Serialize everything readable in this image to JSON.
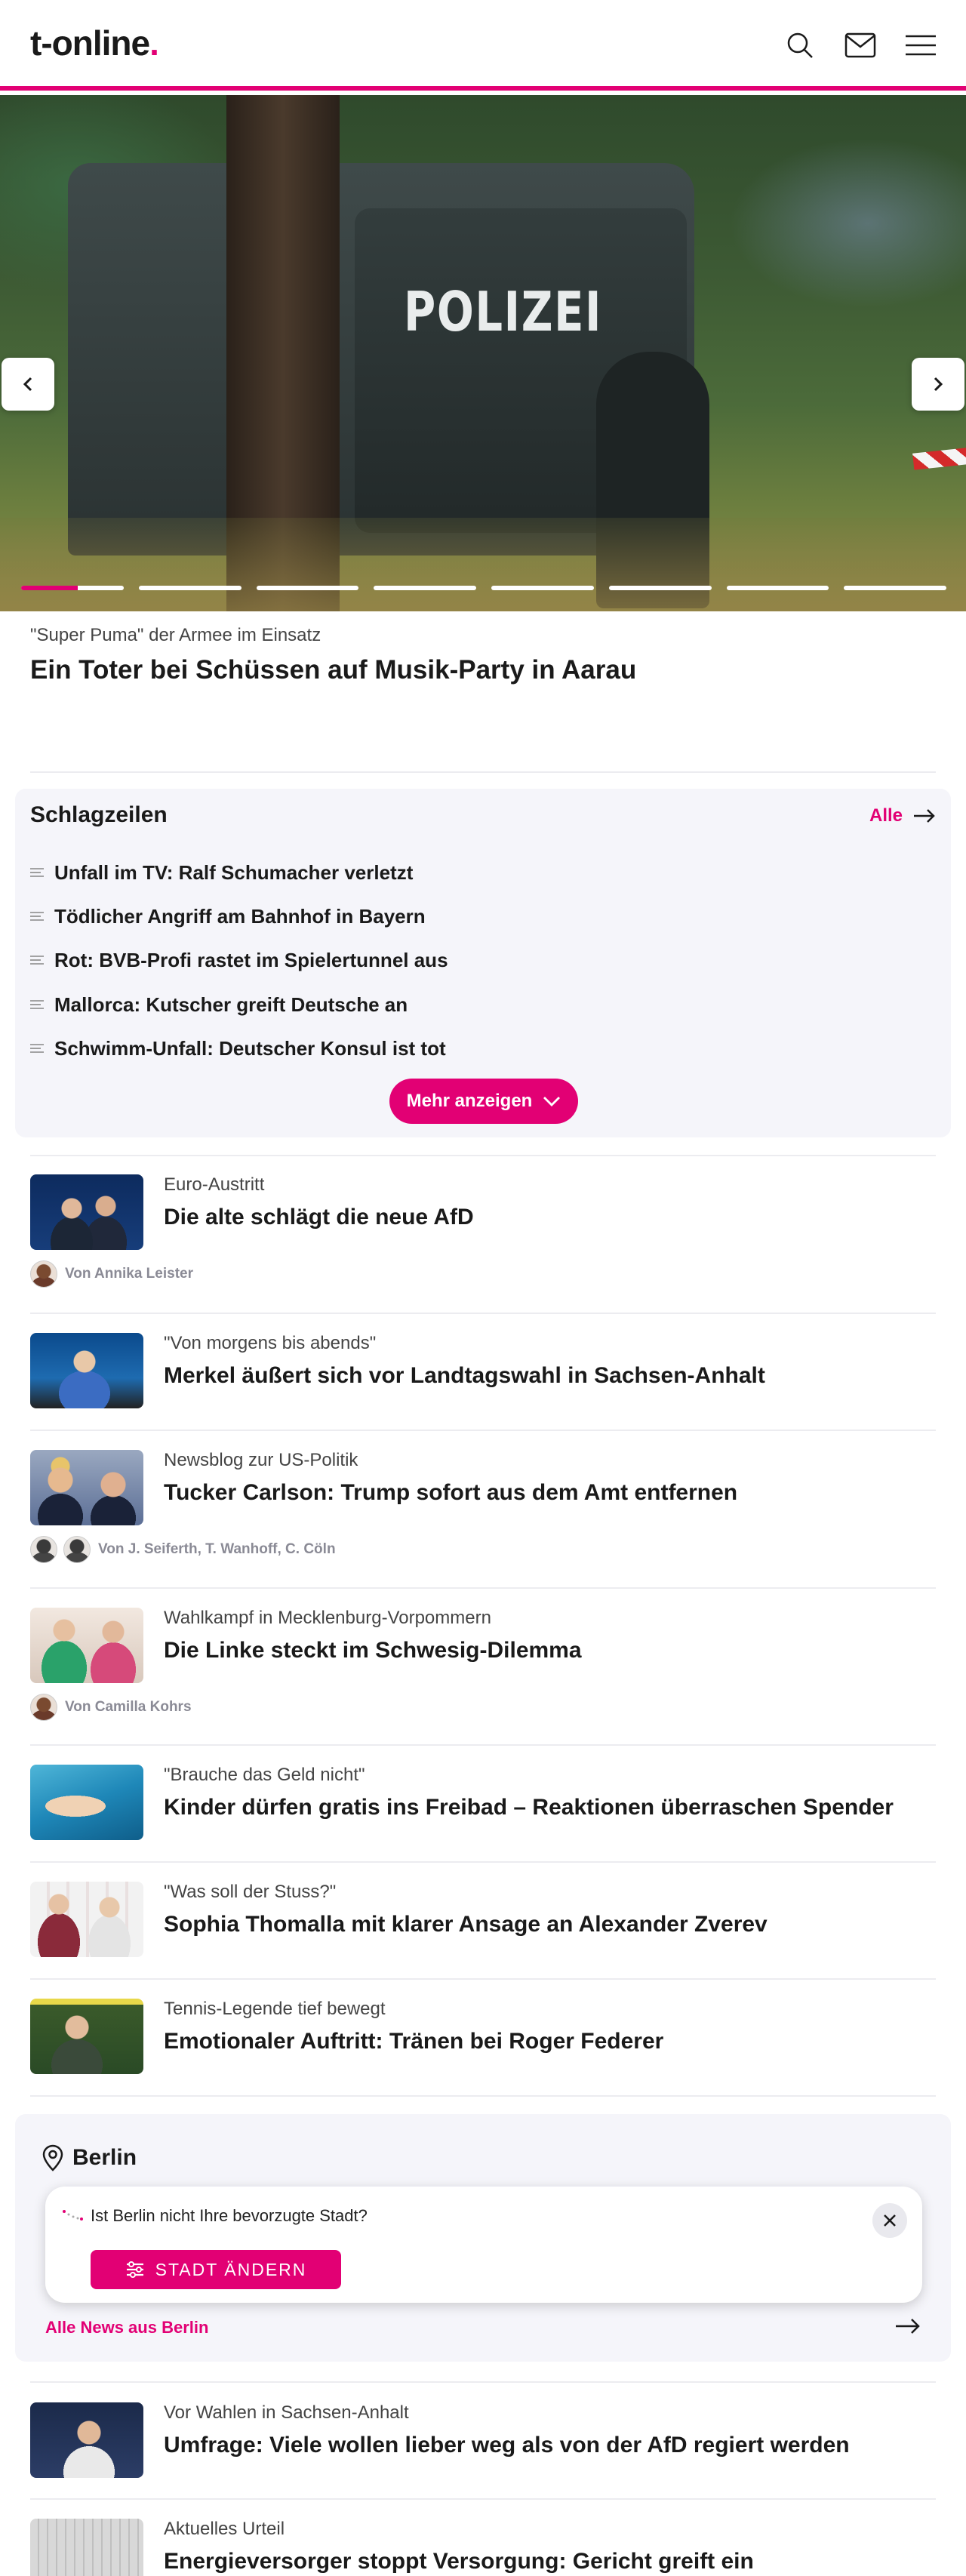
{
  "header": {
    "logo_text": "t-online",
    "logo_dot": "."
  },
  "hero": {
    "vehicle_text": "POLIZEI",
    "kicker": "\"Super Puma\" der Armee im Einsatz",
    "title": "Ein Toter bei Schüssen auf Musik-Party in Aarau",
    "slides": 8,
    "active_slide_progress": 0.55
  },
  "schlagzeilen": {
    "title": "Schlagzeilen",
    "all_label": "Alle",
    "items": [
      "Unfall im TV: Ralf Schumacher verletzt",
      "Tödlicher Angriff am Bahnhof in Bayern",
      "Rot: BVB-Profi rastet im Spielertunnel aus",
      "Mallorca: Kutscher greift Deutsche an",
      "Schwimm-Unfall: Deutscher Konsul ist tot"
    ],
    "more_label": "Mehr anzeigen"
  },
  "articles": [
    {
      "kicker": "Euro-Austritt",
      "title": "Die alte schlägt die neue AfD",
      "author": "Von Annika Leister"
    },
    {
      "kicker": "\"Von morgens bis abends\"",
      "title": "Merkel äußert sich vor Landtagswahl in Sachsen-Anhalt"
    },
    {
      "kicker": "Newsblog zur US-Politik",
      "title": "Tucker Carlson: Trump sofort aus dem Amt entfernen",
      "author": "Von J. Seiferth, T. Wanhoff, C. Cöln"
    },
    {
      "kicker": "Wahlkampf in Mecklenburg-Vorpommern",
      "title": "Die Linke steckt im Schwesig-Dilemma",
      "author": "Von Camilla Kohrs"
    },
    {
      "kicker": "\"Brauche das Geld nicht\"",
      "title": "Kinder dürfen gratis ins Freibad – Reaktionen überraschen Spender"
    },
    {
      "kicker": "\"Was soll der Stuss?\"",
      "title": "Sophia Thomalla mit klarer Ansage an Alexander Zverev"
    },
    {
      "kicker": "Tennis-Legende tief bewegt",
      "title": "Emotionaler Auftritt: Tränen bei Roger Federer"
    }
  ],
  "berlin": {
    "title": "Berlin",
    "popup_text": "Ist Berlin nicht Ihre bevorzugte Stadt?",
    "change_label": "STADT ÄNDERN",
    "all_news_label": "Alle News aus Berlin"
  },
  "articles_bottom": [
    {
      "kicker": "Vor Wahlen in Sachsen-Anhalt",
      "title": "Umfrage: Viele wollen lieber weg als von der AfD regiert werden"
    },
    {
      "kicker": "Aktuelles Urteil",
      "title": "Energieversorger stoppt Versorgung: Gericht greift ein"
    }
  ],
  "colors": {
    "accent": "#e20074",
    "text": "#1a1a1a",
    "muted": "#8a8a95",
    "panel": "#f5f5fa"
  },
  "icons": [
    "search-icon",
    "mail-icon",
    "menu-icon",
    "chevron-left-icon",
    "chevron-right-icon",
    "arrow-right-icon",
    "chevron-down-icon",
    "location-pin-icon",
    "close-icon",
    "sliders-icon",
    "lines-icon"
  ]
}
